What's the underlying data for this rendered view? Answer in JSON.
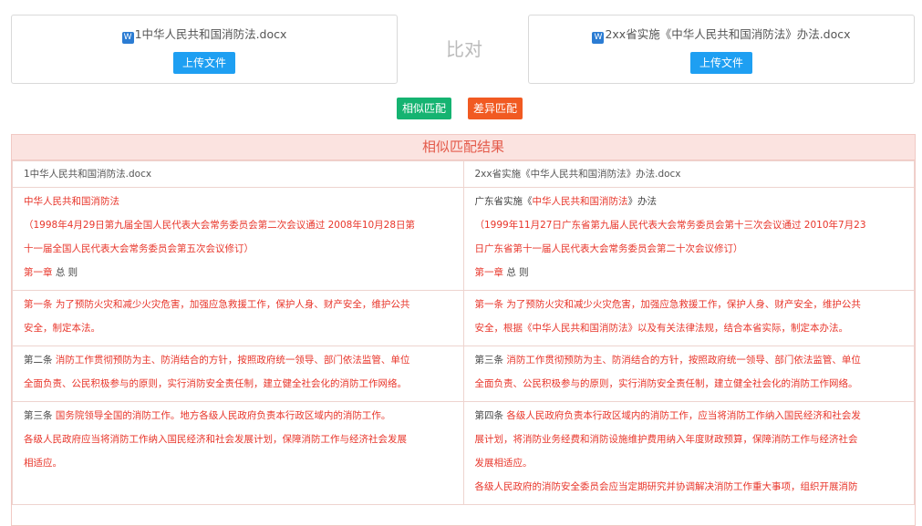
{
  "left_file": {
    "icon": "word-doc-icon",
    "name": "1中华人民共和国消防法.docx",
    "upload_label": "上传文件"
  },
  "right_file": {
    "icon": "word-doc-icon",
    "name": "2xx省实施《中华人民共和国消防法》办法.docx",
    "upload_label": "上传文件"
  },
  "compare_label": "比对",
  "buttons": {
    "similar": "相似匹配",
    "diff": "差异匹配"
  },
  "colors": {
    "upload": "#1e9ff2",
    "similar": "#15b371",
    "diff": "#f15a22",
    "match_text": "#e8352a"
  },
  "results": {
    "title": "相似匹配结果",
    "headers": [
      "1中华人民共和国消防法.docx",
      "2xx省实施《中华人民共和国消防法》办法.docx"
    ],
    "rows": [
      {
        "left": [
          [
            {
              "t": "中华人民共和国消防法",
              "c": "red"
            }
          ],
          [
            {
              "t": "（1998年4月29日第九届全国人民代表大会常务委员会第二次会议通过 2008年10月28日第",
              "c": "red"
            }
          ],
          [
            {
              "t": "十一届全国人民代表大会常务委员会第五次会议修订）",
              "c": "red"
            }
          ],
          [
            {
              "t": "第一章 ",
              "c": "red"
            },
            {
              "t": "总 则",
              "c": "blk"
            }
          ]
        ],
        "right": [
          [
            {
              "t": "广东省实施《",
              "c": "blk"
            },
            {
              "t": "中华人民共和国消防法",
              "c": "red"
            },
            {
              "t": "》办法",
              "c": "blk"
            }
          ],
          [
            {
              "t": "（1999年11月27日广东省第九届人民代表大会常务委员会第十三次会议通过 2010年7月23",
              "c": "red"
            }
          ],
          [
            {
              "t": "日广东省第十一届人民代表大会常务委员会第二十次会议修订）",
              "c": "red"
            }
          ],
          [
            {
              "t": "第一章 ",
              "c": "red"
            },
            {
              "t": "总 则",
              "c": "blk"
            }
          ]
        ]
      },
      {
        "left": [
          [
            {
              "t": "第一条 为了预防火灾和减少火灾危害，加强应急救援工作，保护人身、财产安全，维护公共",
              "c": "red"
            }
          ],
          [
            {
              "t": "安全，制定本法。",
              "c": "red"
            }
          ]
        ],
        "right": [
          [
            {
              "t": "第一条 为了预防火灾和减少火灾危害，加强应急救援工作，保护人身、财产安全，维护公共",
              "c": "red"
            }
          ],
          [
            {
              "t": "安全，根据《中华人民共和国消防法》以及有关法律法规，结合本省实际，制定本办法。",
              "c": "red"
            }
          ]
        ]
      },
      {
        "left": [
          [
            {
              "t": "第二条 ",
              "c": "blk"
            },
            {
              "t": "消防工作贯彻预防为主、防消结合的方针，按照政府统一领导、部门依法监管、单位",
              "c": "red"
            }
          ],
          [
            {
              "t": "全面负责、公民积极参与的原则，实行消防安全责任制，建立健全社会化的消防工作网络。",
              "c": "red"
            }
          ]
        ],
        "right": [
          [
            {
              "t": "第三条 ",
              "c": "blk"
            },
            {
              "t": "消防工作贯彻预防为主、防消结合的方针，按照政府统一领导、部门依法监管、单位",
              "c": "red"
            }
          ],
          [
            {
              "t": "全面负责、公民积极参与的原则，实行消防安全责任制，建立健全社会化的消防工作网络。",
              "c": "red"
            }
          ]
        ]
      },
      {
        "left": [
          [
            {
              "t": "第三条 ",
              "c": "blk"
            },
            {
              "t": "国务院领导全国的消防工作。地方各级人民政府负责本行政区域内的消防工作。",
              "c": "red"
            }
          ],
          [
            {
              "t": "各级人民政府应当将消防工作纳入国民经济和社会发展计划，保障消防工作与经济社会发展",
              "c": "red"
            }
          ],
          [
            {
              "t": "相适应。",
              "c": "red"
            }
          ]
        ],
        "right": [
          [
            {
              "t": "第四条 ",
              "c": "blk"
            },
            {
              "t": "各级人民政府负责本行政区域内的消防工作，应当将消防工作纳入国民经济和社会发",
              "c": "red"
            }
          ],
          [
            {
              "t": "展计划，将消防业务经费和消防设施维护费用纳入年度财政预算，保障消防工作与经济社会",
              "c": "red"
            }
          ],
          [
            {
              "t": "发展相适应。",
              "c": "red"
            }
          ],
          [
            {
              "t": "各级人民政府的消防安全委员会应当定期研究并协调解决消防工作重大事项，组织开展消防",
              "c": "red"
            }
          ]
        ]
      }
    ]
  }
}
